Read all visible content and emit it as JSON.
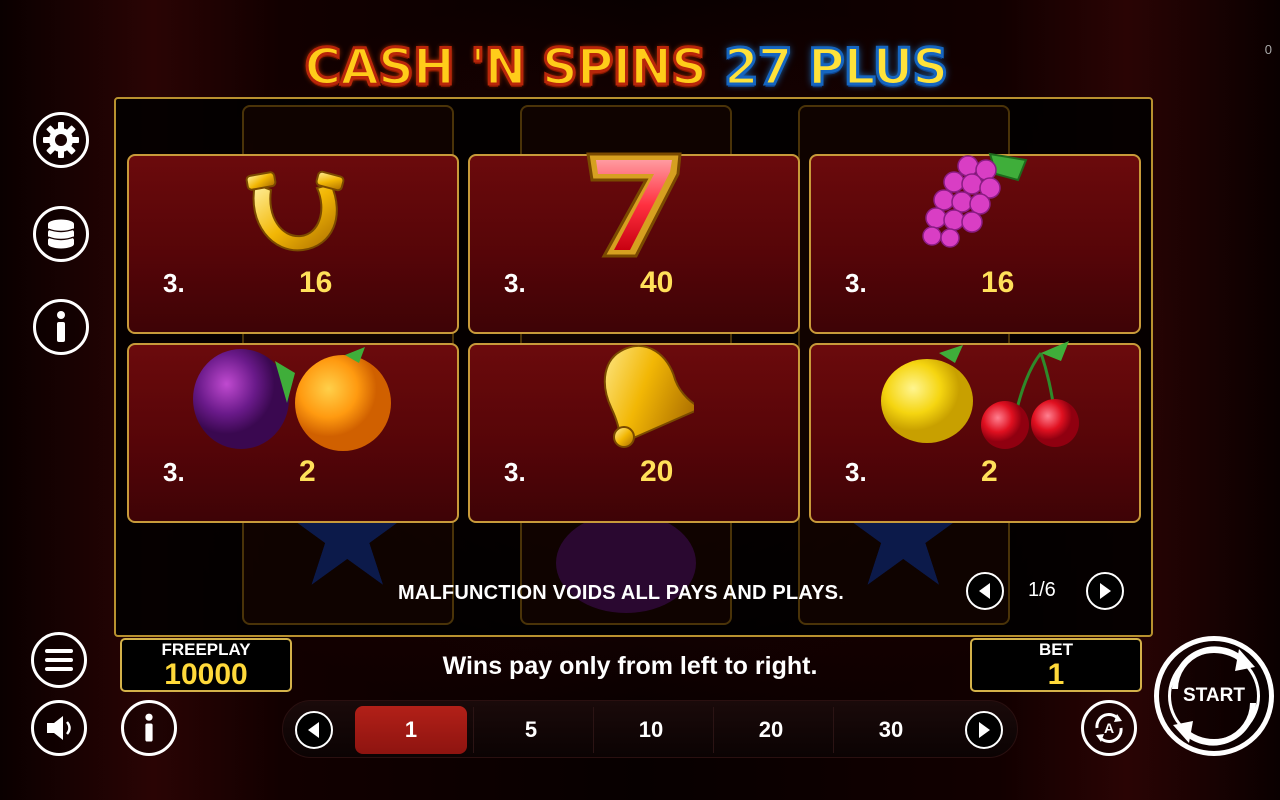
{
  "title": {
    "part1": "CASH 'N SPINS",
    "part2": "27 PLUS"
  },
  "corner_counter": "0",
  "left_menu": [
    {
      "id": "settings",
      "icon": "gear-icon"
    },
    {
      "id": "coins",
      "icon": "coin-stack-icon"
    },
    {
      "id": "info",
      "icon": "info-icon"
    }
  ],
  "paytable": {
    "cards": [
      {
        "symbol": "horseshoe",
        "count": "3.",
        "pay": "16"
      },
      {
        "symbol": "seven",
        "count": "3.",
        "pay": "40"
      },
      {
        "symbol": "grapes",
        "count": "3.",
        "pay": "16"
      },
      {
        "symbol": "plum-orange",
        "count": "3.",
        "pay": "2"
      },
      {
        "symbol": "bell",
        "count": "3.",
        "pay": "20"
      },
      {
        "symbol": "lemon-cherry",
        "count": "3.",
        "pay": "2"
      }
    ],
    "notice": "MALFUNCTION VOIDS ALL PAYS AND PLAYS.",
    "page": "1/6"
  },
  "footer": {
    "freeplay_label": "FREEPLAY",
    "freeplay_value": "10000",
    "message": "Wins pay only from left to right.",
    "bet_label": "BET",
    "bet_value": "1",
    "bet_options": [
      "1",
      "5",
      "10",
      "20",
      "30"
    ],
    "selected_bet": "1",
    "start_label": "START"
  },
  "colors": {
    "accent_gold": "#d4b24a",
    "card_red": "#6b0a0c",
    "pay_yellow": "#ffe05a",
    "selected_red": "#b22018"
  }
}
